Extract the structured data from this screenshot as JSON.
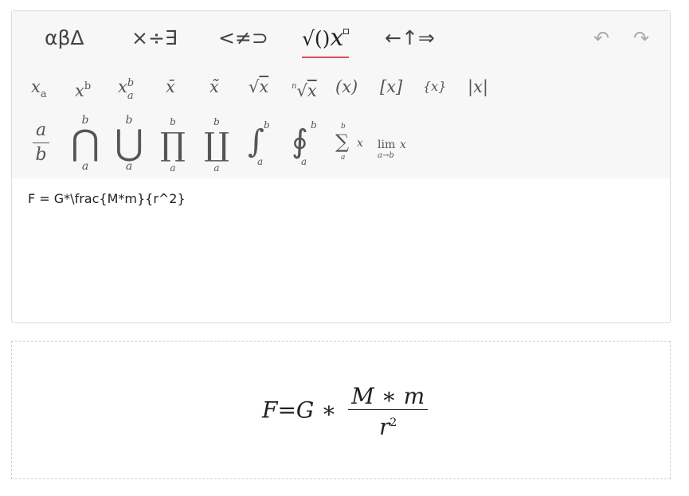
{
  "tabs": [
    {
      "label": "αβΔ"
    },
    {
      "label": "×÷∃"
    },
    {
      "label": "<≠⊃"
    },
    {
      "label": "√()",
      "var": "x",
      "active": true
    },
    {
      "label": "←↑⇒"
    }
  ],
  "actions": {
    "undo": "↶",
    "redo": "↷"
  },
  "row1": {
    "subscript": {
      "base": "x",
      "sub": "a"
    },
    "superscript": {
      "base": "x",
      "sup": "b"
    },
    "subsup": {
      "base": "x",
      "sub": "a",
      "sup": "b"
    },
    "bar": "x̄",
    "tilde": "x̃",
    "sqrt": {
      "sym": "√",
      "arg": "x"
    },
    "nthroot": {
      "n": "n",
      "sym": "√",
      "arg": "x"
    },
    "paren": "(x)",
    "bracket": "[x]",
    "brace": "{x}",
    "abs": "|x|"
  },
  "row2": {
    "frac": {
      "num": "a",
      "den": "b"
    },
    "bigcap": {
      "sym": "⋂",
      "upper": "b",
      "lower": "a"
    },
    "bigcup": {
      "sym": "⋃",
      "upper": "b",
      "lower": "a"
    },
    "prod": {
      "sym": "∏",
      "upper": "b",
      "lower": "a"
    },
    "coprod": {
      "sym": "∐",
      "upper": "b",
      "lower": "a"
    },
    "int": {
      "sym": "∫",
      "upper": "b",
      "lower": "a"
    },
    "oint": {
      "sym": "∮",
      "upper": "b",
      "lower": "a"
    },
    "sum": {
      "sym": "∑",
      "upper": "b",
      "lower": "a",
      "arg": "x"
    },
    "lim": {
      "word": "lim",
      "sub": "a→b",
      "arg": "x"
    }
  },
  "input": {
    "value": "F = G*\\frac{M*m}{r^2}"
  },
  "preview": {
    "lhs": "F",
    "eq": "=",
    "G": "G",
    "op": "∗",
    "num": "M ∗ m",
    "den_base": "r",
    "den_exp": "2"
  }
}
